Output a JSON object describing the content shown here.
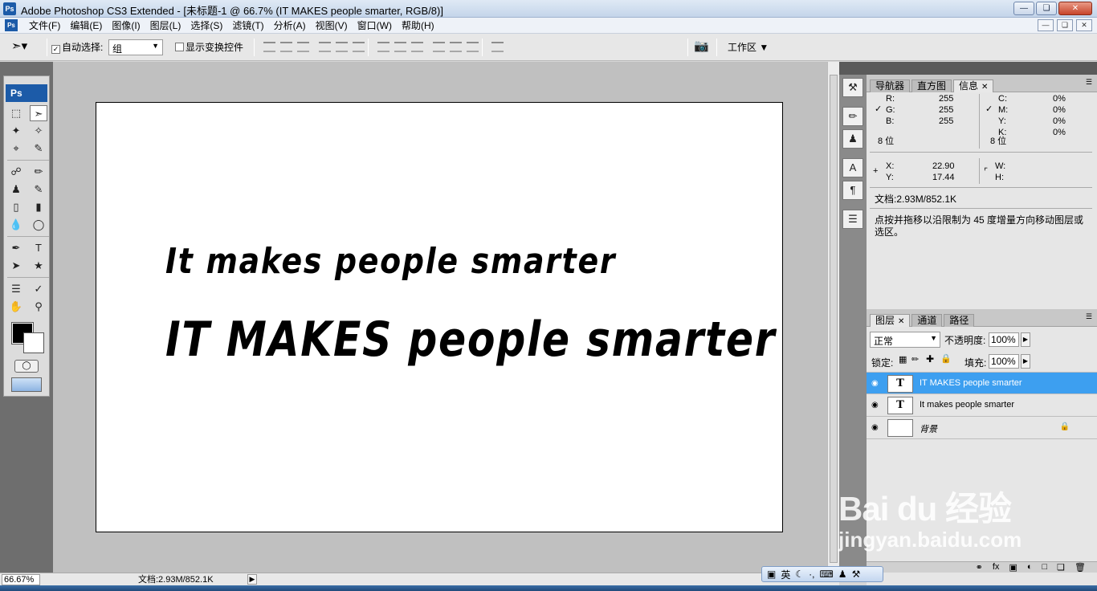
{
  "window": {
    "title": "Adobe Photoshop CS3 Extended - [未标题-1 @ 66.7% (IT  MAKES people smarter, RGB/8)]",
    "app_icon": "Ps",
    "controls": [
      "minimize-icon",
      "restore-icon",
      "close-icon"
    ]
  },
  "menu": {
    "icon": "Ps",
    "items": [
      "文件(F)",
      "编辑(E)",
      "图像(I)",
      "图层(L)",
      "选择(S)",
      "滤镜(T)",
      "分析(A)",
      "视图(V)",
      "窗口(W)",
      "帮助(H)"
    ]
  },
  "options": {
    "auto_select_label": "自动选择:",
    "auto_select_checked": true,
    "auto_select_value": "组",
    "show_transform_label": "显示变换控件",
    "show_transform_checked": false,
    "workspace_label": "工作区"
  },
  "toolbox": {
    "logo": "Ps",
    "foreground_color": "#000000",
    "background_color": "#ffffff"
  },
  "canvas": {
    "line1": "It  makes people  smarter",
    "line2": "IT  MAKES people smarter"
  },
  "status": {
    "zoom": "66.67%",
    "doc_info": "文档:2.93M/852.1K"
  },
  "info_panel": {
    "tabs": [
      "导航器",
      "直方图",
      "信息"
    ],
    "active_tab": "信息",
    "rgb": {
      "r_label": "R:",
      "g_label": "G:",
      "b_label": "B:",
      "r": "255",
      "g": "255",
      "b": "255"
    },
    "cmyk": {
      "c_label": "C:",
      "m_label": "M:",
      "y_label": "Y:",
      "k_label": "K:",
      "c": "0%",
      "m": "0%",
      "y": "0%",
      "k": "0%"
    },
    "bit_depth_left": "8 位",
    "bit_depth_right": "8 位",
    "x_label": "X:",
    "y_label": "Y:",
    "x": "22.90",
    "y": "17.44",
    "w_label": "W:",
    "h_label": "H:",
    "doc_info": "文档:2.93M/852.1K",
    "hint": "点按并拖移以沿限制为 45 度增量方向移动图层或选区。"
  },
  "layers_panel": {
    "tabs": [
      "图层",
      "通道",
      "路径"
    ],
    "active_tab": "图层",
    "blend_mode": "正常",
    "opacity_label": "不透明度:",
    "opacity": "100%",
    "lock_label": "锁定:",
    "fill_label": "填充:",
    "fill": "100%",
    "layers": [
      {
        "name": "IT  MAKES people smarter",
        "thumb": "T",
        "selected": true
      },
      {
        "name": "It  makes people  smarter",
        "thumb": "T",
        "selected": false
      },
      {
        "name": "背景",
        "thumb": "",
        "selected": false
      }
    ]
  },
  "watermark": {
    "brand": "Bai du 经验",
    "url": "jingyan.baidu.com"
  },
  "ime": {
    "lang": "英"
  },
  "colors": {
    "selected_layer": "#3d9ff0",
    "canvas_bg": "#c0c0c0",
    "brand_blue": "#1c5ba8"
  }
}
